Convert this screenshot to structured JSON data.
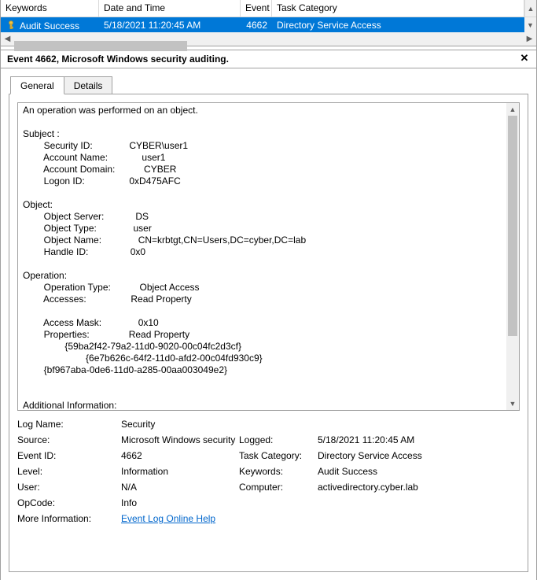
{
  "grid": {
    "headers": {
      "keywords": "Keywords",
      "datetime": "Date and Time",
      "eventid": "Event ID",
      "taskcat": "Task Category"
    },
    "row": {
      "keywords": "Audit Success",
      "datetime": "5/18/2021 11:20:45 AM",
      "eventid": "4662",
      "taskcat": "Directory Service Access"
    }
  },
  "panel_title": "Event 4662, Microsoft Windows security auditing.",
  "tabs": {
    "general": "General",
    "details": "Details"
  },
  "event_text": {
    "intro": "An operation was performed on an object.",
    "sections": {
      "subject_hdr": "Subject :",
      "subject": [
        {
          "label": "Security ID:",
          "value": "CYBER\\user1"
        },
        {
          "label": "Account Name:",
          "value": "user1"
        },
        {
          "label": "Account Domain:",
          "value": "CYBER"
        },
        {
          "label": "Logon ID:",
          "value": "0xD475AFC"
        }
      ],
      "object_hdr": "Object:",
      "object": [
        {
          "label": "Object Server:",
          "value": "DS"
        },
        {
          "label": "Object Type:",
          "value": "user"
        },
        {
          "label": "Object Name:",
          "value": "CN=krbtgt,CN=Users,DC=cyber,DC=lab"
        },
        {
          "label": "Handle ID:",
          "value": "0x0"
        }
      ],
      "operation_hdr": "Operation:",
      "operation1": [
        {
          "label": "Operation Type:",
          "value": "Object Access"
        },
        {
          "label": "Accesses:",
          "value": "Read Property"
        }
      ],
      "operation2": [
        {
          "label": "Access Mask:",
          "value": "0x10"
        },
        {
          "label": "Properties:",
          "value": "Read Property"
        }
      ],
      "guids": [
        "{59ba2f42-79a2-11d0-9020-00c04fc2d3cf}",
        "{6e7b626c-64f2-11d0-afd2-00c04fd930c9}",
        "{bf967aba-0de6-11d0-a285-00aa003049e2}"
      ],
      "addl_hdr": "Additional Information:"
    }
  },
  "props": {
    "logname": {
      "label": "Log Name:",
      "value": "Security"
    },
    "source": {
      "label": "Source:",
      "value": "Microsoft Windows security"
    },
    "logged": {
      "label": "Logged:",
      "value": "5/18/2021 11:20:45 AM"
    },
    "eventid": {
      "label": "Event ID:",
      "value": "4662"
    },
    "taskcat": {
      "label": "Task Category:",
      "value": "Directory Service Access"
    },
    "level": {
      "label": "Level:",
      "value": "Information"
    },
    "keywords": {
      "label": "Keywords:",
      "value": "Audit Success"
    },
    "user": {
      "label": "User:",
      "value": "N/A"
    },
    "computer": {
      "label": "Computer:",
      "value": "activedirectory.cyber.lab"
    },
    "opcode": {
      "label": "OpCode:",
      "value": "Info"
    },
    "moreinfo": {
      "label": "More Information:",
      "link": "Event Log Online Help"
    }
  }
}
